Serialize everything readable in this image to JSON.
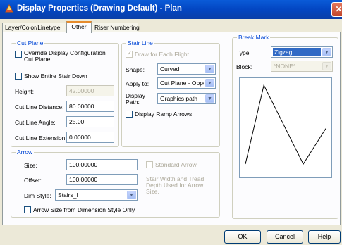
{
  "window": {
    "title": "Display Properties (Drawing Default) - Plan",
    "close_glyph": "✕"
  },
  "tabs": [
    {
      "label": "Layer/Color/Linetype"
    },
    {
      "label": "Other"
    },
    {
      "label": "Riser Numbering"
    }
  ],
  "cut_plane": {
    "legend": "Cut Plane",
    "override_label_1": "Override Display Configuration",
    "override_label_2": "Cut Plane",
    "override_checked": false,
    "show_entire_label": "Show Entire Stair Down",
    "show_entire_checked": false,
    "height_label": "Height:",
    "height_value": "42.00000",
    "cut_distance_label": "Cut Line Distance:",
    "cut_distance_value": "80.00000",
    "cut_angle_label": "Cut Line Angle:",
    "cut_angle_value": "25.00",
    "cut_extension_label": "Cut Line Extension:",
    "cut_extension_value": "0.00000"
  },
  "stair_line": {
    "legend": "Stair Line",
    "draw_each_label": "Draw for Each Flight",
    "draw_each_checked": true,
    "shape_label": "Shape:",
    "shape_value": "Curved",
    "apply_label": "Apply to:",
    "apply_value": "Cut Plane - Opposite",
    "display_path_label_1": "Display",
    "display_path_label_2": "Path:",
    "display_path_value": "Graphics path",
    "ramp_label": "Display Ramp Arrows",
    "ramp_checked": false
  },
  "break_mark": {
    "legend": "Break Mark",
    "type_label": "Type:",
    "type_value": "Zigzag",
    "block_label": "Block:",
    "block_value": "*NONE*",
    "preview_points": [
      [
        0.0,
        1.0
      ],
      [
        0.23,
        0.0
      ],
      [
        0.72,
        1.0
      ],
      [
        1.0,
        0.55
      ]
    ]
  },
  "arrow": {
    "legend": "Arrow",
    "size_label": "Size:",
    "size_value": "100.00000",
    "offset_label": "Offset:",
    "offset_value": "100.00000",
    "dim_style_label": "Dim Style:",
    "dim_style_value": "Stairs_I",
    "standard_label": "Standard Arrow",
    "standard_checked": false,
    "note": [
      "Stair Width and Tread",
      "Depth Used for Arrow",
      "Size."
    ],
    "size_from_dim_label": "Arrow Size from Dimension Style Only",
    "size_from_dim_checked": false
  },
  "buttons": {
    "ok": "OK",
    "cancel": "Cancel",
    "help": "Help"
  },
  "colors": {
    "titlebar": "#0346c2",
    "legend_text": "#0046d5",
    "selected_bg": "#316ac5",
    "disabled_text": "#aca899"
  }
}
